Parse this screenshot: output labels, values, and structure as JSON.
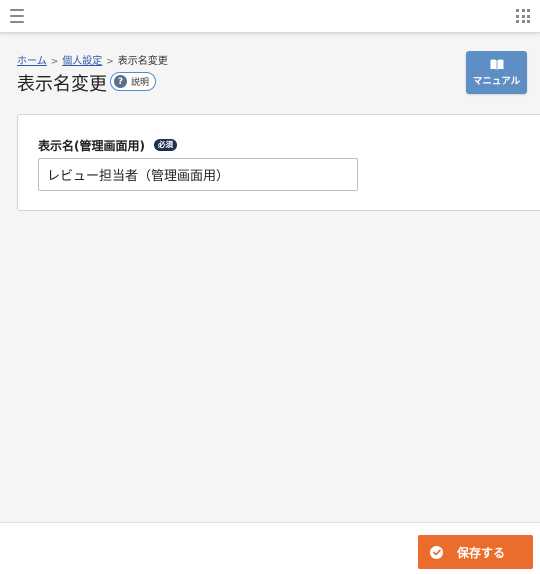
{
  "topbar": {
    "menu_icon": "hamburger-icon",
    "apps_icon": "grid-icon"
  },
  "breadcrumb": {
    "items": [
      "ホーム",
      "個人設定"
    ],
    "separator": ">",
    "current": "表示名変更"
  },
  "page": {
    "title": "表示名変更",
    "help_label": "説明",
    "help_icon": "question-icon"
  },
  "manual": {
    "label": "マニュアル",
    "icon": "book-icon"
  },
  "form": {
    "field_label": "表示名(管理画面用)",
    "required_label": "必須",
    "display_name_value": "レビュー担当者（管理画面用）"
  },
  "footer": {
    "save_label": "保存する",
    "save_icon": "check-circle-icon"
  },
  "colors": {
    "accent_orange": "#ec6c2c",
    "manual_blue": "#5d8fc4",
    "badge_navy": "#1f2f4f",
    "link_blue": "#2b5aa6"
  }
}
